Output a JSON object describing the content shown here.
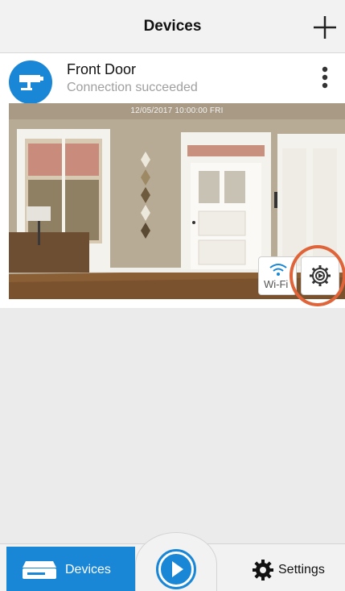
{
  "header": {
    "title": "Devices",
    "add_icon": "plus-icon"
  },
  "device": {
    "name": "Front Door",
    "status": "Connection succeeded",
    "icon": "camera-icon",
    "camera": {
      "timestamp": "12/05/2017 10:00:00 FRI",
      "wifi_label": "Wi-Fi",
      "settings_icon": "gear-icon"
    }
  },
  "tabbar": {
    "devices_label": "Devices",
    "settings_label": "Settings",
    "play_icon": "play-icon"
  },
  "colors": {
    "accent": "#1a87d6",
    "highlight": "#e0643a"
  }
}
